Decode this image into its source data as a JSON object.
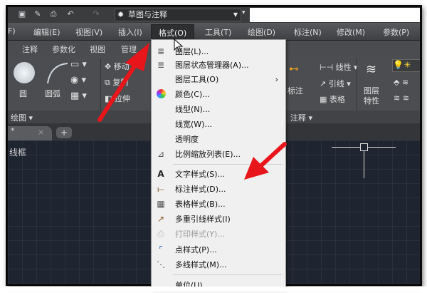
{
  "quick_access": {
    "workspace": "草图与注释",
    "icons": [
      "save-icon",
      "save-as-icon",
      "print-icon",
      "undo-icon",
      "redo-icon"
    ]
  },
  "menubar": [
    {
      "label": "F)"
    },
    {
      "label": "编辑(E)"
    },
    {
      "label": "视图(V)"
    },
    {
      "label": "插入(I)"
    },
    {
      "label": "格式(O)",
      "active": true
    },
    {
      "label": "工具(T)"
    },
    {
      "label": "绘图(D)"
    },
    {
      "label": "标注(N)"
    },
    {
      "label": "修改(M)"
    },
    {
      "label": "参数(P)"
    }
  ],
  "ribbon_tabs": [
    "注释",
    "参数化",
    "视图",
    "管理"
  ],
  "ribbon": {
    "circle": "圆",
    "arc": "圆弧",
    "move": "移动",
    "copy": "复制",
    "stretch": "拉伸",
    "dimension": "标注",
    "linear": "线性",
    "leader": "引线",
    "table": "表格",
    "layer_props_1": "图层",
    "layer_props_2": "特性",
    "panel_draw": "绘图",
    "panel_annotation": "注释"
  },
  "file_tab": {
    "name": "*",
    "close": "×",
    "new": "+"
  },
  "viewport_label": "线框",
  "format_menu": [
    {
      "label": "图层(L)...",
      "icon": "layer-icon"
    },
    {
      "label": "图层状态管理器(A)...",
      "icon": "layer-state-icon"
    },
    {
      "label": "图层工具(O)",
      "submenu": "›"
    },
    {
      "label": "颜色(C)...",
      "icon": "color-wheel-icon"
    },
    {
      "label": "线型(N)..."
    },
    {
      "label": "线宽(W)..."
    },
    {
      "label": "透明度"
    },
    {
      "label": "比例缩放列表(E)...",
      "icon": "scale-list-icon"
    },
    {
      "label": "文字样式(S)...",
      "icon": "text-style-icon"
    },
    {
      "label": "标注样式(D)...",
      "icon": "dim-style-icon"
    },
    {
      "label": "表格样式(B)...",
      "icon": "table-style-icon"
    },
    {
      "label": "多重引线样式(I)",
      "icon": "mleader-style-icon"
    },
    {
      "label": "打印样式(Y)...",
      "icon": "plot-style-icon",
      "disabled": true
    },
    {
      "label": "点样式(P)...",
      "icon": "point-style-icon"
    },
    {
      "label": "多线样式(M)...",
      "icon": "mline-style-icon"
    },
    {
      "label": "单位(U)..."
    }
  ],
  "colors": {
    "arrow": "#e8161b",
    "canvas": "#1f2530",
    "menu_bg": "#f0f0f0"
  }
}
